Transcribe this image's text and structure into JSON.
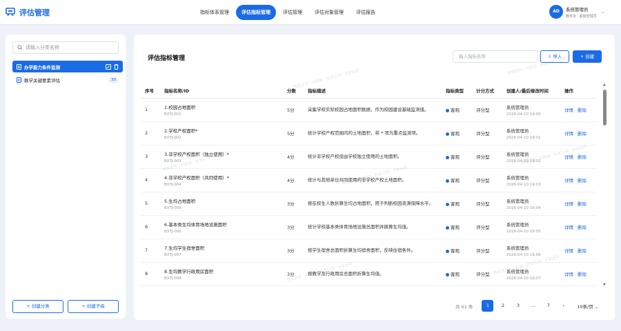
{
  "app": {
    "title": "评估管理"
  },
  "nav": [
    {
      "label": "指标体系管理",
      "active": false
    },
    {
      "label": "评估指标管理",
      "active": true
    },
    {
      "label": "评估管理",
      "active": false
    },
    {
      "label": "评估对象管理",
      "active": false
    },
    {
      "label": "评估报告",
      "active": false
    }
  ],
  "user": {
    "initials": "AD",
    "name": "系统管理员",
    "sub": "教务处 · 超级管理员"
  },
  "sidebar": {
    "search_placeholder": "请输入分类名称",
    "items": [
      {
        "label": "办学能力条件监测",
        "active": true
      },
      {
        "label": "教学关键要素评估",
        "count": "30"
      }
    ],
    "create_category": "+ 创建分类",
    "create_child": "+ 创建子级"
  },
  "main": {
    "title": "评估指标管理",
    "search_placeholder": "输入指标名称",
    "import_label": "导入",
    "create_label": "+ 创建",
    "columns": [
      "序号",
      "指标名称/ID",
      "分数",
      "指标描述",
      "指标类型",
      "计分方式",
      "创建人/最后修改时间",
      "操作"
    ],
    "rows": [
      {
        "no": "1",
        "name": "1.校园占地面积",
        "id": "BXTJ-001",
        "score": "5分",
        "desc": "采集学校实际校园占地面积数据，作为校园建设基础监测值。",
        "type": "客观",
        "method": "评分型",
        "creator": "系统管理员",
        "time": "2026-04-10 19:00"
      },
      {
        "no": "2",
        "name": "2.学校产权面积*",
        "id": "BXTJ-002",
        "score": "5分",
        "desc": "统计学校产权范围内的土地面积，带 * 项为重点监测项。",
        "type": "客观",
        "method": "评分型",
        "creator": "系统管理员",
        "time": "2026-04-10 19:01"
      },
      {
        "no": "3",
        "name": "3.非学校产权面积（独立使用）*",
        "id": "BXTJ-003",
        "score": "4分",
        "desc": "统计非学校产权但由学校独立使用的土地面积。",
        "type": "客观",
        "method": "评分型",
        "creator": "系统管理员",
        "time": "2026-04-10 19:02"
      },
      {
        "no": "4",
        "name": "4.非学校产权面积（共同使用）*",
        "id": "BXTJ-004",
        "score": "4分",
        "desc": "统计与其他单位共同使用的非学校产权土地面积。",
        "type": "客观",
        "method": "评分型",
        "creator": "系统管理员",
        "time": "2026-04-10 19:03"
      },
      {
        "no": "5",
        "name": "5.生均占地面积",
        "id": "BXTJ-005",
        "score": "3分",
        "desc": "按在校生人数折算生均占地面积，用于判断校园资源保障水平。",
        "type": "客观",
        "method": "评分型",
        "creator": "系统管理员",
        "time": "2026-04-10 19:04"
      },
      {
        "no": "6",
        "name": "6.基本类生均体育场地设施面积",
        "id": "BXTJ-006",
        "score": "3分",
        "desc": "统计学校基本类体育场地设施总面积并换算生均值。",
        "type": "客观",
        "method": "评分型",
        "creator": "系统管理员",
        "time": "2026-04-10 19:05"
      },
      {
        "no": "7",
        "name": "7.生均学生宿舍面积",
        "id": "BXTJ-007",
        "score": "3分",
        "desc": "按学生宿舍总面积折算生均宿舍面积，反映住宿条件。",
        "type": "客观",
        "method": "评分型",
        "creator": "系统管理员",
        "time": "2026-04-10 19:06"
      },
      {
        "no": "8",
        "name": "8.生均教学行政用房面积",
        "id": "BXTJ-008",
        "score": "3分",
        "desc": "按教学及行政用房总面积折算生均值。",
        "type": "客观",
        "method": "评分型",
        "creator": "系统管理员",
        "time": "2026-04-10 19:07"
      }
    ],
    "op_detail": "详情",
    "op_delete": "删除"
  },
  "pager": {
    "total": "共 61 条",
    "pages": [
      "1",
      "2",
      "3",
      "...",
      "7"
    ],
    "prev": "‹",
    "next": "›",
    "size": "10条/页"
  },
  "watermark": "数据支持 · AI赋能 · 标准引领 · 专家指导",
  "colors": {
    "accent": "#1a6be6"
  }
}
